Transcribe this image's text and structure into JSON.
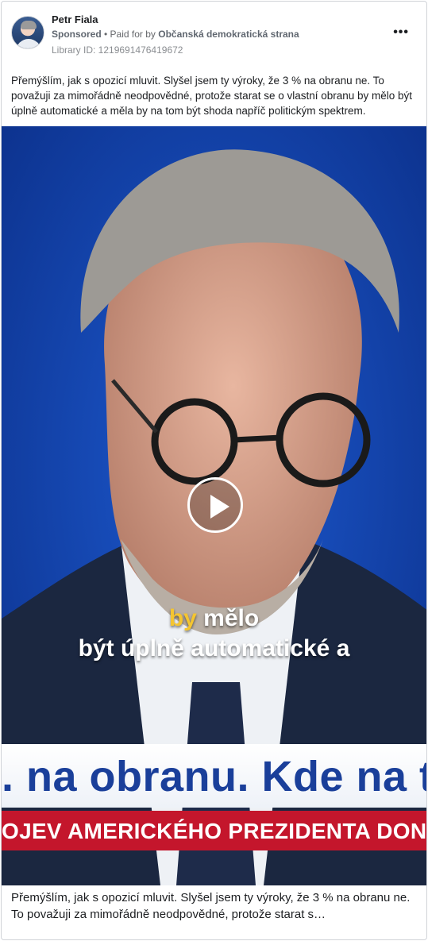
{
  "header": {
    "page_name": "Petr Fiala",
    "sponsored_label": "Sponsored",
    "paid_for_prefix": " • Paid for by ",
    "paid_for_name": "Občanská demokratická strana",
    "library_id": "Library ID: 1219691476419672",
    "more_icon": "more-options-icon",
    "more_glyph": "•••"
  },
  "ad_text": "Přemýšlím, jak s opozicí mluvit. Slyšel jsem ty výroky, že 3 % na obranu ne. To považuji za mimořádně neodpovědné, protože starat se o vlastní obranu by mělo být úplně automatické a měla by na tom být shoda napříč politickým spektrem.",
  "video": {
    "play_icon": "play-icon",
    "subtitle_highlight": "by",
    "subtitle_line1_rest": " mělo",
    "subtitle_line2": "být úplně automatické a",
    "banner_headline": ". na obranu. Kde na t",
    "banner_ticker": "OJEV AMERICKÉHO PREZIDENTA DONA",
    "colors": {
      "background_blue": "#1346b8",
      "subtitle_highlight": "#f4c531",
      "banner_text": "#1a3f9a",
      "ticker_red": "#c4162c"
    }
  },
  "caption": "Přemýšlím, jak s opozicí mluvit. Slyšel jsem ty výroky, že 3 % na obranu ne. To považuji za mimořádně neodpovědné, protože starat s…"
}
